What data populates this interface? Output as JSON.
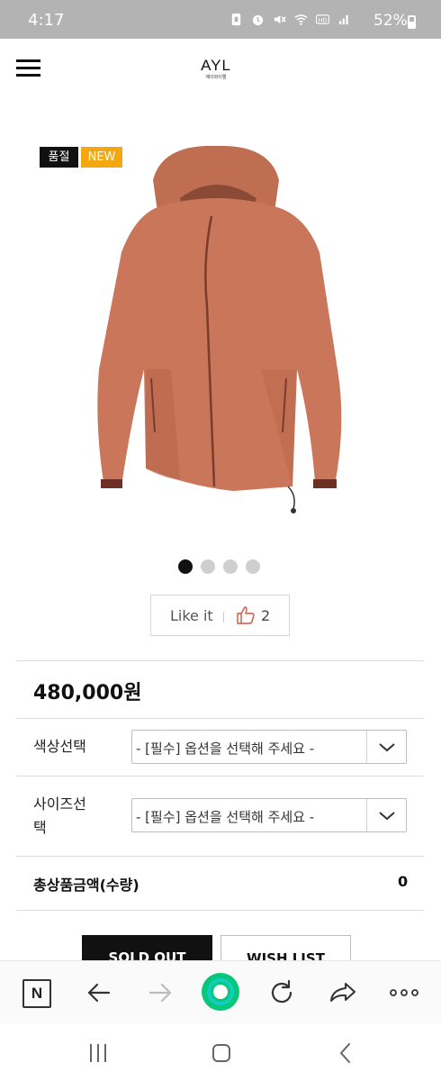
{
  "status_bar": {
    "time": "4:17",
    "battery": "52%",
    "battery_level": 0.52,
    "icons": [
      "nfc-icon",
      "alarm-icon",
      "mute-icon",
      "wifi-icon",
      "hd-icon",
      "signal-icon",
      "battery-icon"
    ]
  },
  "header": {
    "logo": "AYL",
    "logo_sub": "에이와이엘",
    "menu_icon": "hamburger-icon"
  },
  "product": {
    "badges": {
      "sold_out": "품절",
      "new": "NEW"
    },
    "badge_colors": {
      "sold_out": "#111111",
      "new": "#f3a711"
    },
    "image": "rust-orange hooded windbreaker jacket",
    "jacket_color": "#c9765a",
    "slide_count": 4,
    "active_slide": 1,
    "like_label": "Like it",
    "like_count": "2",
    "price": "480,000원",
    "options": [
      {
        "label": "색상선택",
        "placeholder": "- [필수] 옵션을 선택해 주세요 -"
      },
      {
        "label": "사이즈선\n택",
        "placeholder": "- [필수] 옵션을 선택해 주세요 -"
      }
    ],
    "total_label": "총상품금액(수량)",
    "total_value": "0",
    "sold_out_button": "SOLD OUT",
    "wish_button": "WISH LIST"
  },
  "browser_bar": {
    "n_label": "N",
    "buttons": [
      "naver-icon",
      "back-icon",
      "forward-icon",
      "home-icon",
      "refresh-icon",
      "share-icon",
      "more-icon"
    ],
    "accent": "#07c77a"
  },
  "system_nav": [
    "recents-icon",
    "home-icon",
    "back-icon"
  ]
}
